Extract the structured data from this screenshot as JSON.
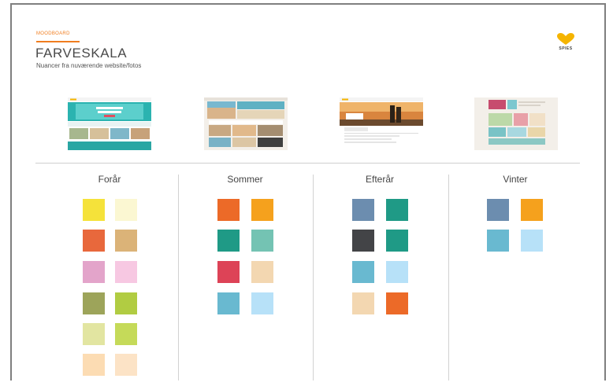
{
  "header": {
    "section_tag": "MOODBOARD",
    "title": "FARVESKALA",
    "subtitle": "Nuancer fra nuværende website/fotos"
  },
  "logo": {
    "text": "SPIES",
    "heart_color": "#f5b400"
  },
  "screenshots": [
    {
      "name": "website-screenshot-1",
      "theme": "teal"
    },
    {
      "name": "website-screenshot-2",
      "theme": "beach"
    },
    {
      "name": "website-screenshot-3",
      "theme": "sunset"
    },
    {
      "name": "website-screenshot-4",
      "theme": "pastel"
    }
  ],
  "seasons": [
    {
      "name": "Forår",
      "colors": [
        "#f5e23a",
        "#fbf7d2",
        "#e8683c",
        "#dbb378",
        "#e3a4ca",
        "#f7c8e2",
        "#9da45a",
        "#b1cc42",
        "#e2e5a1",
        "#c5da59",
        "#fcdcb3",
        "#fce3c6"
      ]
    },
    {
      "name": "Sommer",
      "colors": [
        "#ec6a28",
        "#f5a11d",
        "#1f9a86",
        "#74c3b3",
        "#dd4357",
        "#f3d7b1",
        "#69b9d0",
        "#b7e1f8"
      ]
    },
    {
      "name": "Efterår",
      "colors": [
        "#6c8daf",
        "#1f9a86",
        "#434447",
        "#1f9a86",
        "#69b9d0",
        "#b7e1f8",
        "#f3d7b1",
        "#ec6a28"
      ]
    },
    {
      "name": "Vinter",
      "colors": [
        "#6c8daf",
        "#f5a11d",
        "#69b9d0",
        "#b7e1f8"
      ]
    }
  ]
}
